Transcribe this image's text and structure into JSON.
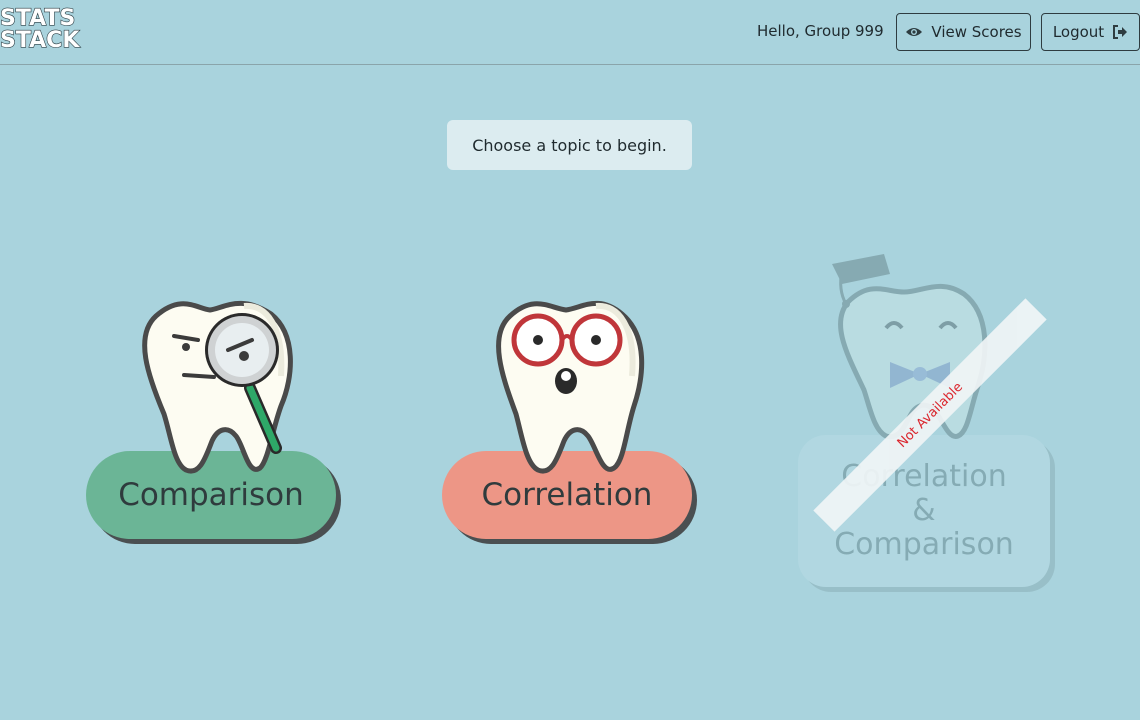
{
  "logo": {
    "line1": "STATS",
    "line2": "STACK"
  },
  "header": {
    "greeting": "Hello, Group 999",
    "view_scores_label": "View Scores",
    "logout_label": "Logout"
  },
  "prompt": "Choose a topic to begin.",
  "topics": [
    {
      "label": "Comparison",
      "color": "#6bb596",
      "available": true
    },
    {
      "label": "Correlation",
      "color": "#ed9686",
      "available": true
    },
    {
      "label_line1": "Correlation",
      "label_line2": "&",
      "label_line3": "Comparison",
      "available": false,
      "ribbon": "Not Available"
    }
  ],
  "colors": {
    "background": "#a9d3dd",
    "prompt_bg": "#dcecf0",
    "ribbon_text": "#e0141b"
  },
  "icons": [
    "eye-icon",
    "sign-out-icon",
    "tooth-magnifier-icon",
    "tooth-glasses-icon",
    "tooth-graduate-icon"
  ]
}
